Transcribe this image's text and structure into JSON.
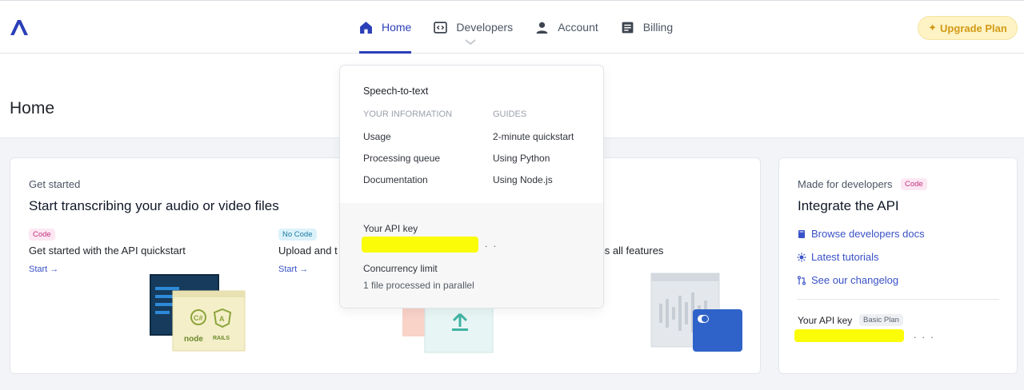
{
  "nav": {
    "items": [
      {
        "label": "Home",
        "icon": "home-icon"
      },
      {
        "label": "Developers",
        "icon": "code-icon"
      },
      {
        "label": "Account",
        "icon": "user-icon"
      },
      {
        "label": "Billing",
        "icon": "billing-icon"
      }
    ],
    "upgrade_label": "Upgrade Plan",
    "accent_color": "#2b3fb8"
  },
  "page": {
    "title": "Home"
  },
  "get_started": {
    "eyebrow": "Get started",
    "title": "Start transcribing your audio or video files",
    "options": [
      {
        "tag": "Code",
        "title": "Get started with the API quickstart",
        "cta": "Start →"
      },
      {
        "tag": "No Code",
        "title": "Upload and t",
        "cta": "Start →"
      },
      {
        "title": "ess all features"
      }
    ]
  },
  "developers_card": {
    "eyebrow": "Made for developers",
    "tag": "Code",
    "title": "Integrate the API",
    "links": [
      "Browse developers docs",
      "Latest tutorials",
      "See our changelog"
    ],
    "api_key_label": "Your API key",
    "plan_badge": "Basic Plan",
    "api_key_suffix": ". . ."
  },
  "dropdown": {
    "title": "Speech-to-text",
    "your_info_header": "YOUR INFORMATION",
    "your_info": [
      "Usage",
      "Processing queue",
      "Documentation"
    ],
    "guides_header": "GUIDES",
    "guides": [
      "2-minute quickstart",
      "Using Python",
      "Using Node.js"
    ],
    "api_key_label": "Your API key",
    "api_key_suffix": ". .",
    "concurrency_label": "Concurrency limit",
    "concurrency_value": "1 file processed in parallel"
  },
  "illustration_labels": {
    "node": "node",
    "rails": "RAILS"
  }
}
